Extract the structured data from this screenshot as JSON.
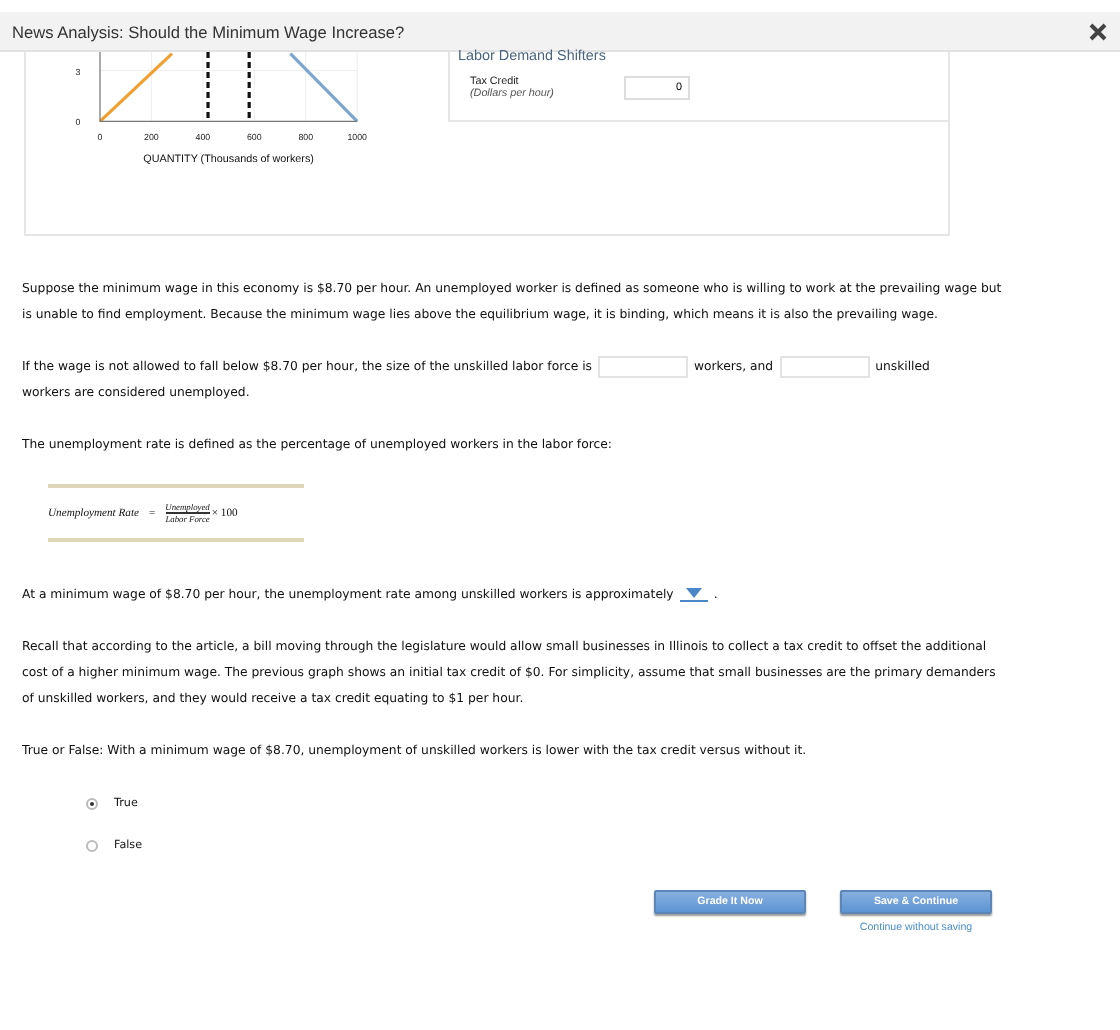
{
  "window": {
    "title": "News Analysis: Should the Minimum Wage Increase?"
  },
  "graph": {
    "chart_data": {
      "type": "line",
      "xlabel": "QUANTITY (Thousands of workers)",
      "x": [
        0,
        280,
        740,
        1000
      ],
      "xlim": [
        0,
        1000
      ],
      "ylim": [
        0,
        4.1
      ],
      "xticks": [
        0,
        200,
        400,
        600,
        800,
        1000
      ],
      "yticks": [
        0,
        3
      ],
      "grid": true,
      "series": [
        {
          "color": "#f0a030",
          "values": [
            0,
            4,
            null,
            null
          ]
        },
        {
          "color": "#7aa6d0",
          "values": [
            null,
            null,
            4,
            0
          ]
        }
      ],
      "ref_lines": [
        {
          "axis": "x",
          "value": 420
        },
        {
          "axis": "x",
          "value": 580
        }
      ]
    }
  },
  "shifters": {
    "title": "Labor Demand Shifters",
    "fields": [
      {
        "label": "Tax Credit",
        "unit": "(Dollars per hour)",
        "value": "0"
      }
    ]
  },
  "intro": "Suppose the minimum wage in this economy is $8.70 per hour. An unemployed worker is defined as someone who is willing to work at the prevailing wage but is unable to find employment. Because the minimum wage lies above the equilibrium wage, it is binding, which means it is also the prevailing wage.",
  "labor_force_question": {
    "parts": [
      "If the wage is not allowed to fall below $8.70 per hour, the size of the unskilled labor force is",
      "workers, and",
      "unskilled"
    ],
    "continuation": "workers are considered unemployed."
  },
  "definition": "The unemployment rate is defined as the percentage of unemployed workers in the labor force:",
  "formula": {
    "lhs": "Unemployment Rate",
    "equals": "=",
    "numerator": "Unemployed",
    "denominator": "Labor Force",
    "multiplier": "× 100"
  },
  "rate_question": {
    "before": "At a minimum wage of $8.70 per hour, the unemployment rate among unskilled workers is approximately",
    "after": "."
  },
  "recall": "Recall that according to the article, a bill moving through the legislature would allow small businesses in Illinois to collect a tax credit to offset the additional cost of a higher minimum wage. The previous graph shows an initial tax credit of $0. For simplicity, assume that small businesses are the primary demanders of unskilled workers, and they would receive a tax credit equating to $1 per hour.",
  "tf_question": "True or False: With a minimum wage of $8.70, unemployment of unskilled workers is lower with the tax credit versus without it.",
  "options": [
    {
      "label": "True",
      "selected": true
    },
    {
      "label": "False",
      "selected": false
    }
  ],
  "buttons": [
    "Grade It Now",
    "Save & Continue"
  ],
  "link": "Continue without saving"
}
